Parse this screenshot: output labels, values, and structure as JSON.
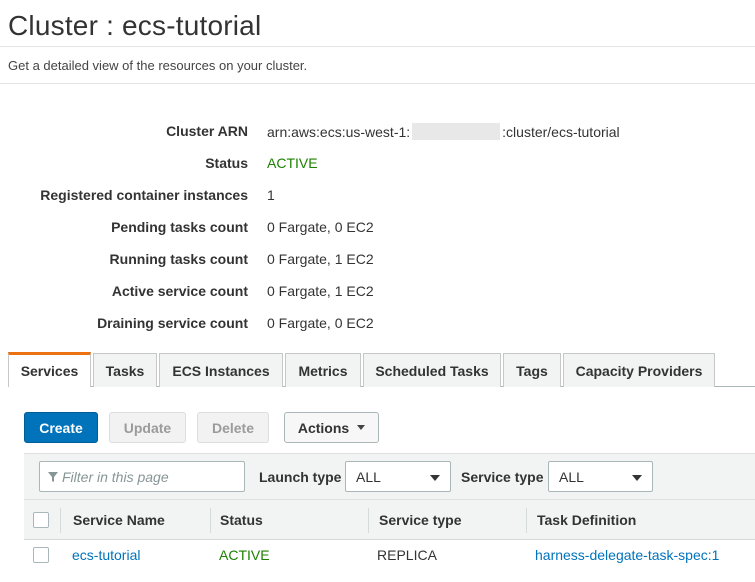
{
  "header": {
    "title": "Cluster : ecs-tutorial",
    "subtitle": "Get a detailed view of the resources on your cluster."
  },
  "details": {
    "cluster_arn_label": "Cluster ARN",
    "cluster_arn_prefix": "arn:aws:ecs:us-west-1:",
    "cluster_arn_suffix": ":cluster/ecs-tutorial",
    "status_label": "Status",
    "status_value": "ACTIVE",
    "registered_label": "Registered container instances",
    "registered_value": "1",
    "pending_label": "Pending tasks count",
    "pending_value": "0 Fargate, 0 EC2",
    "running_label": "Running tasks count",
    "running_value": "0 Fargate, 1 EC2",
    "active_service_label": "Active service count",
    "active_service_value": "0 Fargate, 1 EC2",
    "draining_label": "Draining service count",
    "draining_value": "0 Fargate, 0 EC2"
  },
  "tabs": [
    "Services",
    "Tasks",
    "ECS Instances",
    "Metrics",
    "Scheduled Tasks",
    "Tags",
    "Capacity Providers"
  ],
  "toolbar": {
    "create": "Create",
    "update": "Update",
    "delete": "Delete",
    "actions": "Actions"
  },
  "filters": {
    "search_placeholder": "Filter in this page",
    "launch_type_label": "Launch type",
    "launch_type_value": "ALL",
    "service_type_label": "Service type",
    "service_type_value": "ALL"
  },
  "table": {
    "columns": [
      "Service Name",
      "Status",
      "Service type",
      "Task Definition"
    ],
    "rows": [
      {
        "service_name": "ecs-tutorial",
        "status": "ACTIVE",
        "service_type": "REPLICA",
        "task_definition": "harness-delegate-task-spec:1"
      }
    ]
  },
  "colors": {
    "primary": "#0073bb",
    "active_status": "#1d8102",
    "tab_accent": "#ec7211"
  }
}
